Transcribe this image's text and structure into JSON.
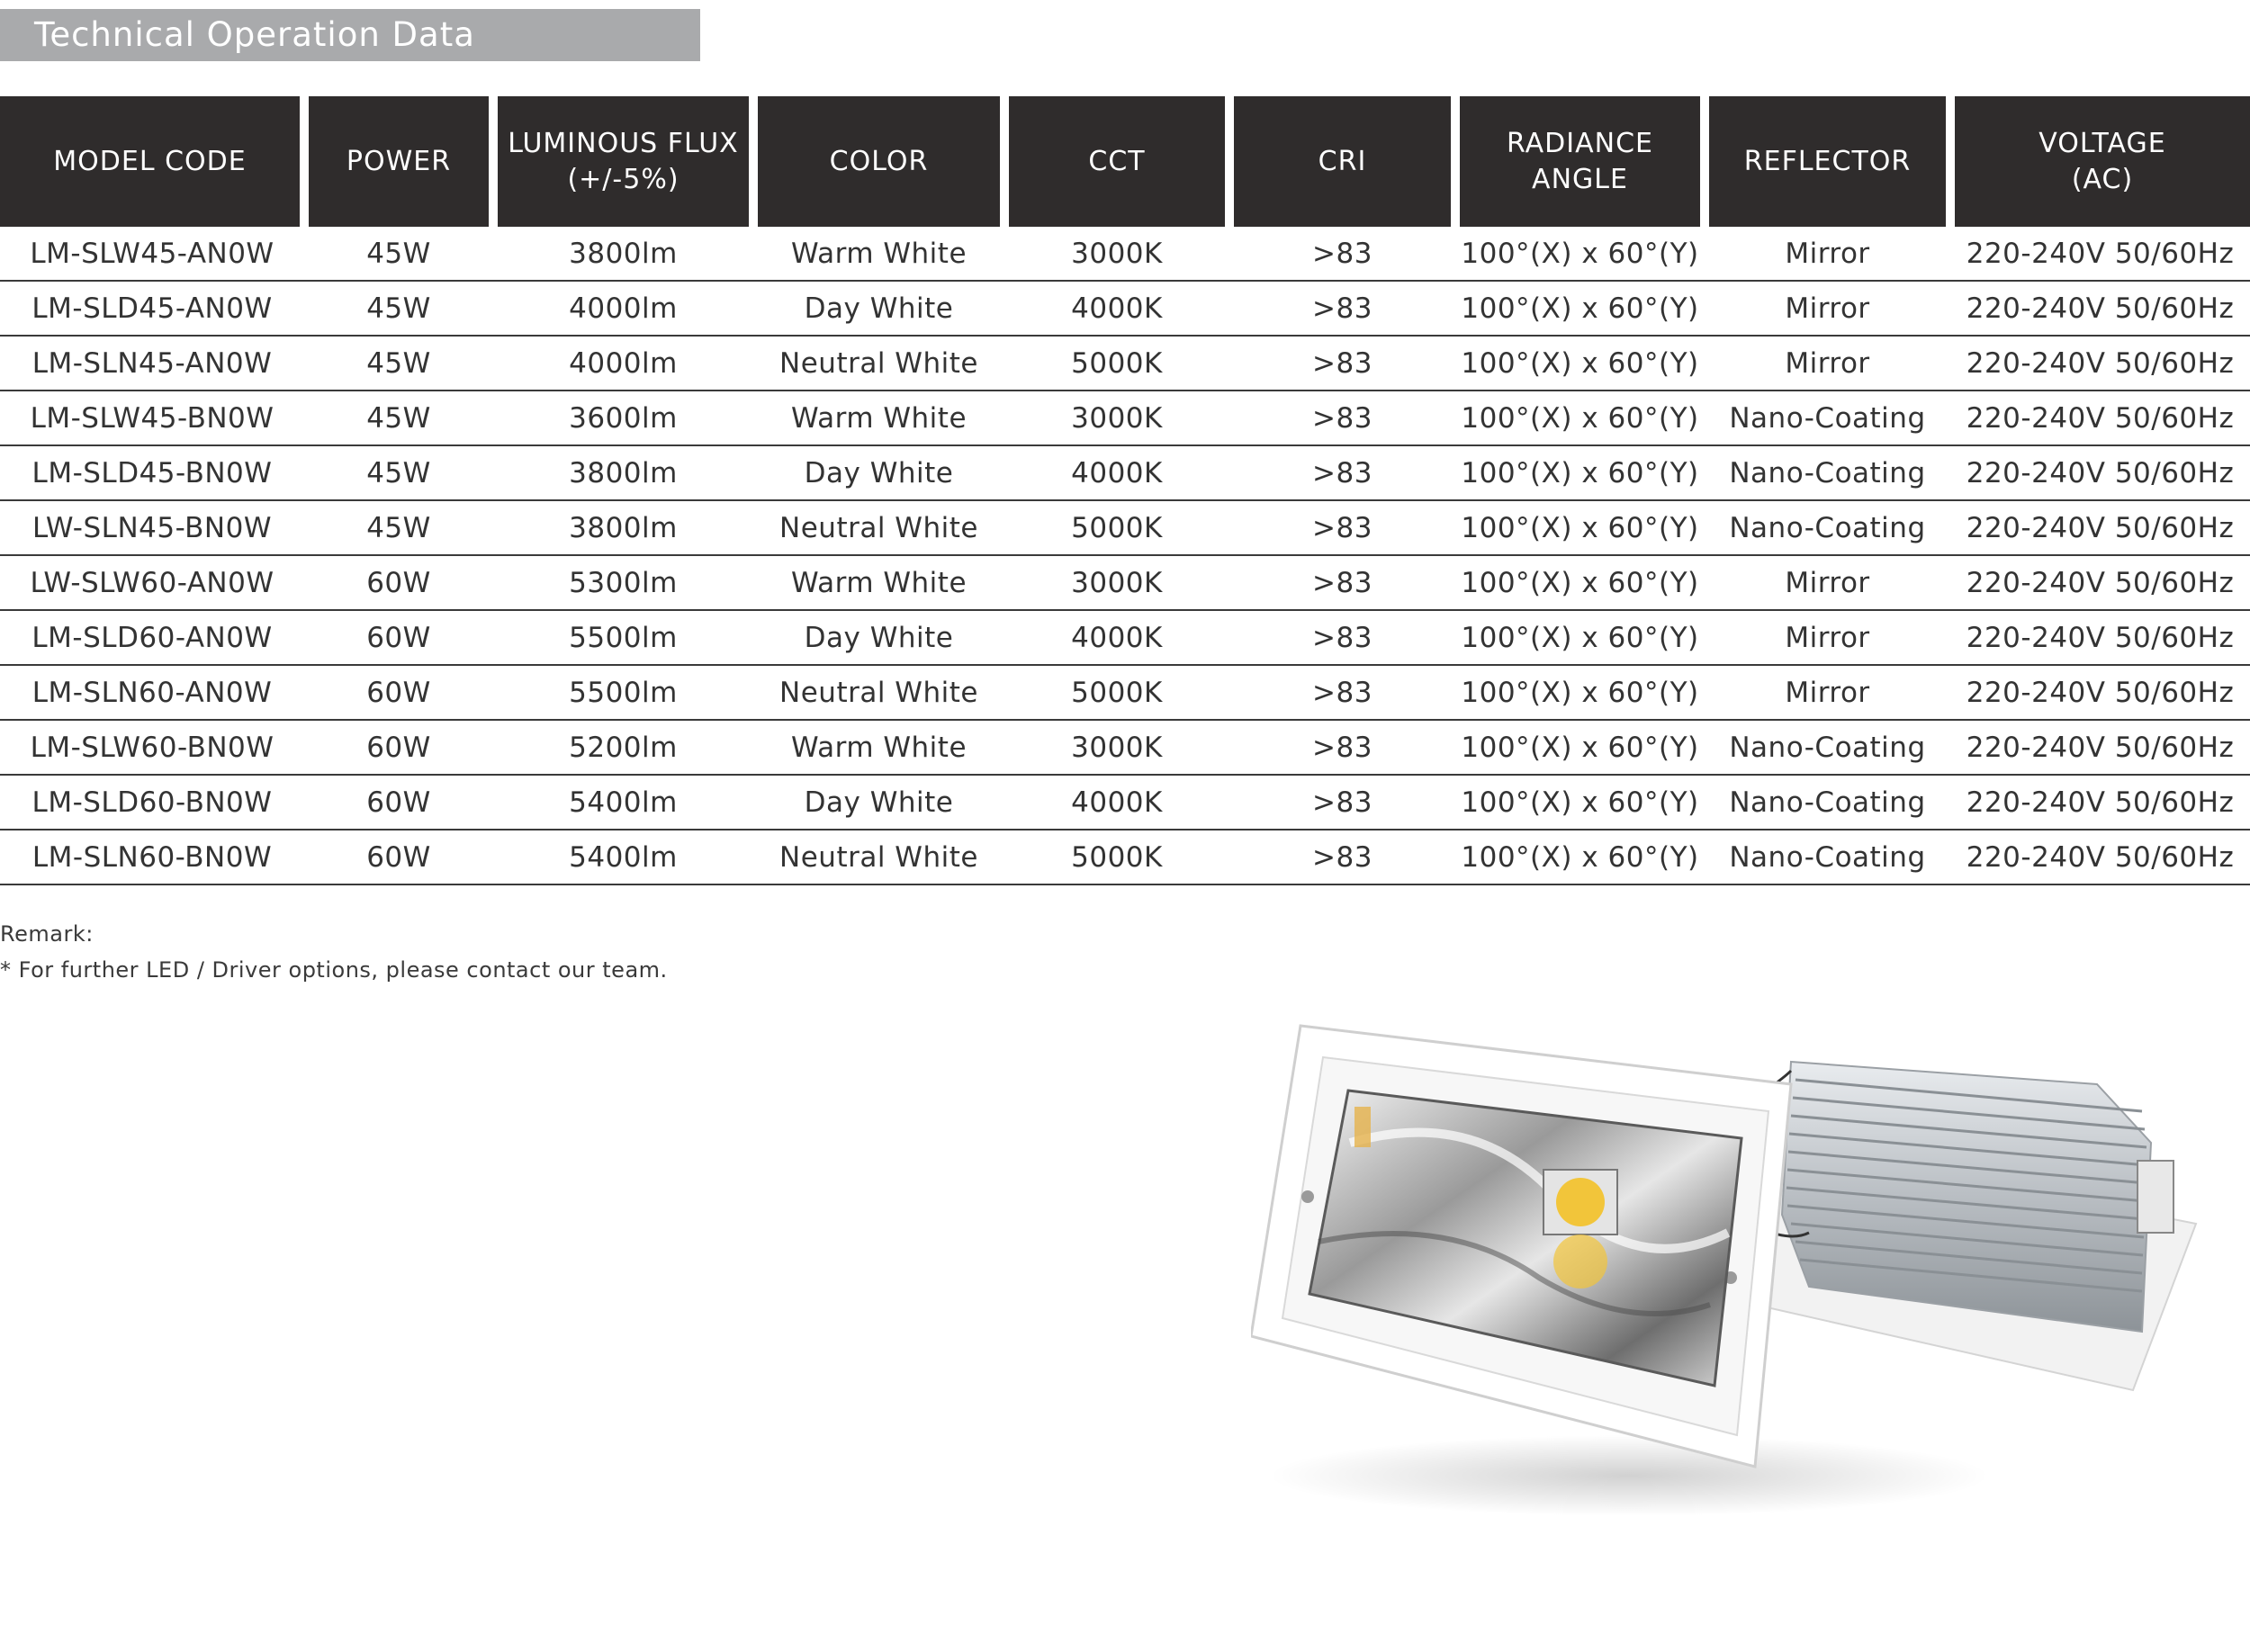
{
  "section_title": "Technical Operation Data",
  "table": {
    "headers": [
      "MODEL CODE",
      "POWER",
      "LUMINOUS FLUX\n(+/-5%)",
      "COLOR",
      "CCT",
      "CRI",
      "RADIANCE\nANGLE",
      "REFLECTOR",
      "VOLTAGE\n(AC)"
    ],
    "rows": [
      [
        "LM-SLW45-AN0W",
        "45W",
        "3800lm",
        "Warm White",
        "3000K",
        ">83",
        "100°(X) x 60°(Y)",
        "Mirror",
        "220-240V 50/60Hz"
      ],
      [
        "LM-SLD45-AN0W",
        "45W",
        "4000lm",
        "Day White",
        "4000K",
        ">83",
        "100°(X) x 60°(Y)",
        "Mirror",
        "220-240V 50/60Hz"
      ],
      [
        "LM-SLN45-AN0W",
        "45W",
        "4000lm",
        "Neutral White",
        "5000K",
        ">83",
        "100°(X) x 60°(Y)",
        "Mirror",
        "220-240V 50/60Hz"
      ],
      [
        "LM-SLW45-BN0W",
        "45W",
        "3600lm",
        "Warm White",
        "3000K",
        ">83",
        "100°(X) x 60°(Y)",
        "Nano-Coating",
        "220-240V 50/60Hz"
      ],
      [
        "LM-SLD45-BN0W",
        "45W",
        "3800lm",
        "Day White",
        "4000K",
        ">83",
        "100°(X) x 60°(Y)",
        "Nano-Coating",
        "220-240V 50/60Hz"
      ],
      [
        "LW-SLN45-BN0W",
        "45W",
        "3800lm",
        "Neutral White",
        "5000K",
        ">83",
        "100°(X) x 60°(Y)",
        "Nano-Coating",
        "220-240V 50/60Hz"
      ],
      [
        "LW-SLW60-AN0W",
        "60W",
        "5300lm",
        "Warm White",
        "3000K",
        ">83",
        "100°(X) x 60°(Y)",
        "Mirror",
        "220-240V 50/60Hz"
      ],
      [
        "LM-SLD60-AN0W",
        "60W",
        "5500lm",
        "Day White",
        "4000K",
        ">83",
        "100°(X) x 60°(Y)",
        "Mirror",
        "220-240V 50/60Hz"
      ],
      [
        "LM-SLN60-AN0W",
        "60W",
        "5500lm",
        "Neutral White",
        "5000K",
        ">83",
        "100°(X) x 60°(Y)",
        "Mirror",
        "220-240V 50/60Hz"
      ],
      [
        "LM-SLW60-BN0W",
        "60W",
        "5200lm",
        "Warm White",
        "3000K",
        ">83",
        "100°(X) x 60°(Y)",
        "Nano-Coating",
        "220-240V 50/60Hz"
      ],
      [
        "LM-SLD60-BN0W",
        "60W",
        "5400lm",
        "Day White",
        "4000K",
        ">83",
        "100°(X) x 60°(Y)",
        "Nano-Coating",
        "220-240V 50/60Hz"
      ],
      [
        "LM-SLN60-BN0W",
        "60W",
        "5400lm",
        "Neutral White",
        "5000K",
        ">83",
        "100°(X) x 60°(Y)",
        "Nano-Coating",
        "220-240V 50/60Hz"
      ]
    ]
  },
  "remark": {
    "label": "Remark:",
    "note": "* For further LED / Driver options, please contact our team."
  },
  "colors": {
    "title_bar": "#a9aaac",
    "header_bg": "#2f2c2c",
    "header_text": "#ffffff",
    "led_chip": "#f2c53a"
  },
  "product_image": {
    "icon": "recessed-led-downlight-photo"
  }
}
